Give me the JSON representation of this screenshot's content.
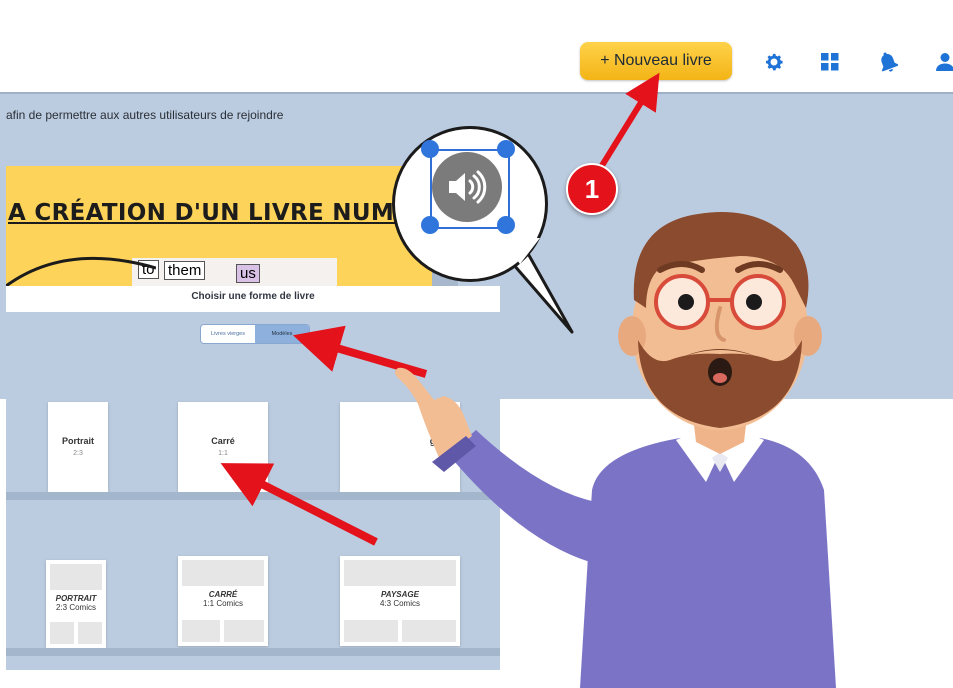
{
  "header": {
    "new_book_label": "+ Nouveau livre",
    "icons": [
      "gear-icon",
      "grid-icon",
      "bell-icon",
      "user-icon"
    ],
    "accent_color": "#f5b81c"
  },
  "app": {
    "info_text": "afin de permettre aux autres utilisateurs de rejoindre",
    "banner_title": "A CRÉATION D'UN LIVRE NUMÉRIQUE",
    "banner_words": [
      "to",
      "them",
      "us"
    ]
  },
  "modal": {
    "title": "Choisir une forme de livre",
    "tabs": [
      {
        "label": "Livres vierges",
        "active": false
      },
      {
        "label": "Modèles",
        "active": true
      }
    ],
    "blank_books": [
      {
        "title": "Portrait",
        "ratio": "2:3"
      },
      {
        "title": "Carré",
        "ratio": "1:1"
      },
      {
        "title": "ge",
        "ratio": ""
      }
    ],
    "comic_books": [
      {
        "title": "PORTRAIT",
        "ratio": "2:3 Comics"
      },
      {
        "title": "CARRÉ",
        "ratio": "1:1 Comics"
      },
      {
        "title": "PAYSAGE",
        "ratio": "4:3 Comics"
      }
    ]
  },
  "callout": {
    "step_number": "1",
    "bubble_icon": "speaker-icon",
    "arrow_color": "#e3121b",
    "selection_color": "#2f75dc"
  }
}
